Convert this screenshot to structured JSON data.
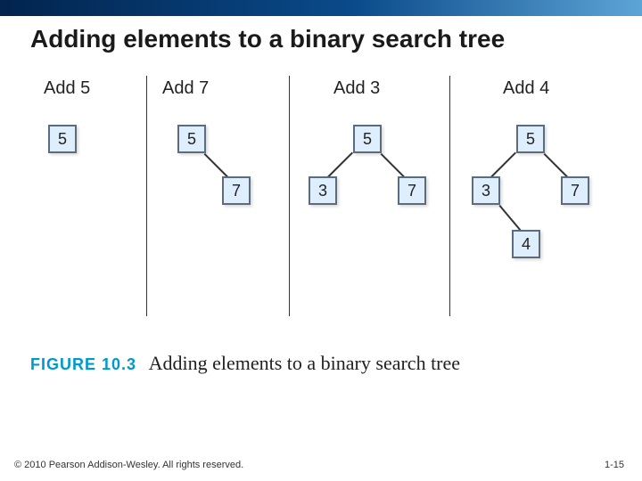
{
  "title": "Adding elements to a binary search tree",
  "columns": [
    {
      "label": "Add 5"
    },
    {
      "label": "Add 7"
    },
    {
      "label": "Add 3"
    },
    {
      "label": "Add 4"
    }
  ],
  "nodes": {
    "c1_root": "5",
    "c2_root": "5",
    "c2_right": "7",
    "c3_root": "5",
    "c3_left": "3",
    "c3_right": "7",
    "c4_root": "5",
    "c4_left": "3",
    "c4_right": "7",
    "c4_leaf": "4"
  },
  "figure": {
    "label": "FIGURE 10.3",
    "title": "Adding elements to a binary search tree"
  },
  "copyright": "© 2010 Pearson Addison-Wesley. All rights reserved.",
  "page": "1-15"
}
